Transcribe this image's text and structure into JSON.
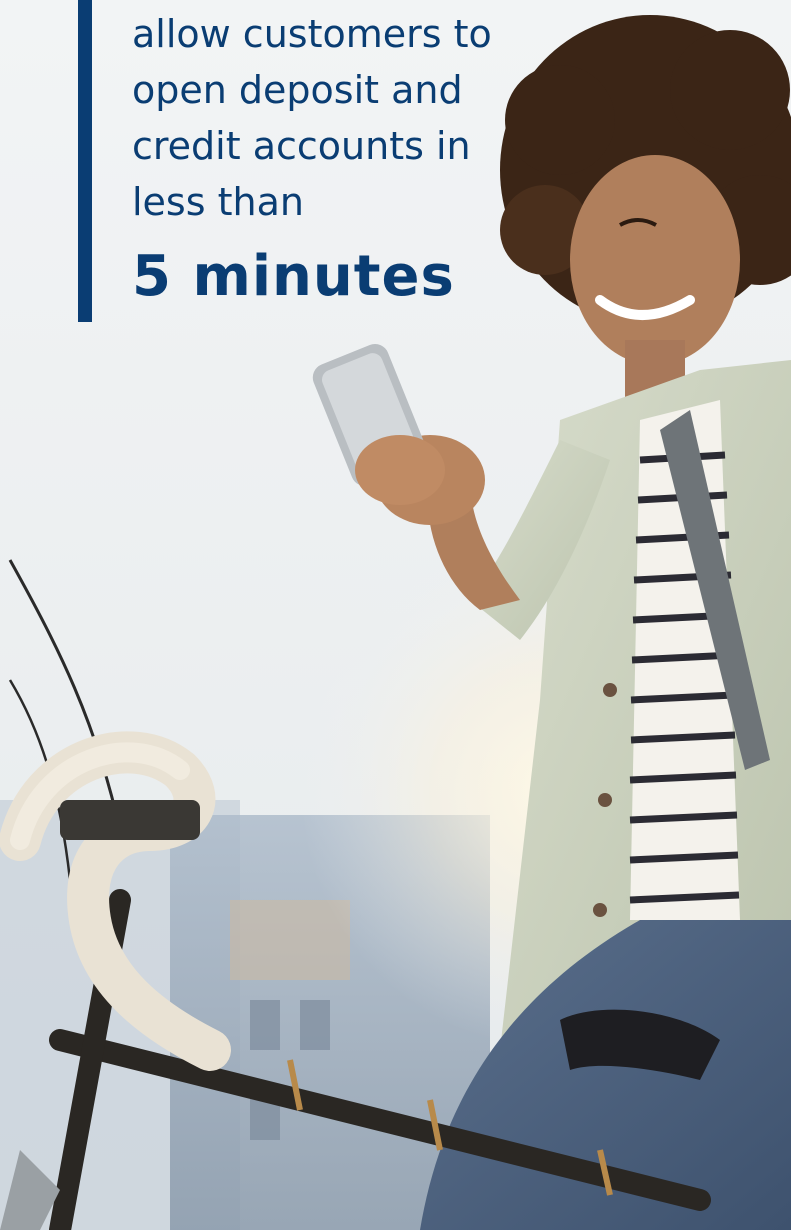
{
  "headline": {
    "lines": [
      "allow customers to",
      "open deposit and",
      "credit accounts in",
      "less than"
    ],
    "highlight": "5 minutes"
  },
  "photo": {
    "icon": "woman-with-phone-on-bicycle-photo"
  },
  "colors": {
    "text": "#0a3d73",
    "accent_bar": "#0a3d73",
    "sky": "#eef1f2"
  }
}
